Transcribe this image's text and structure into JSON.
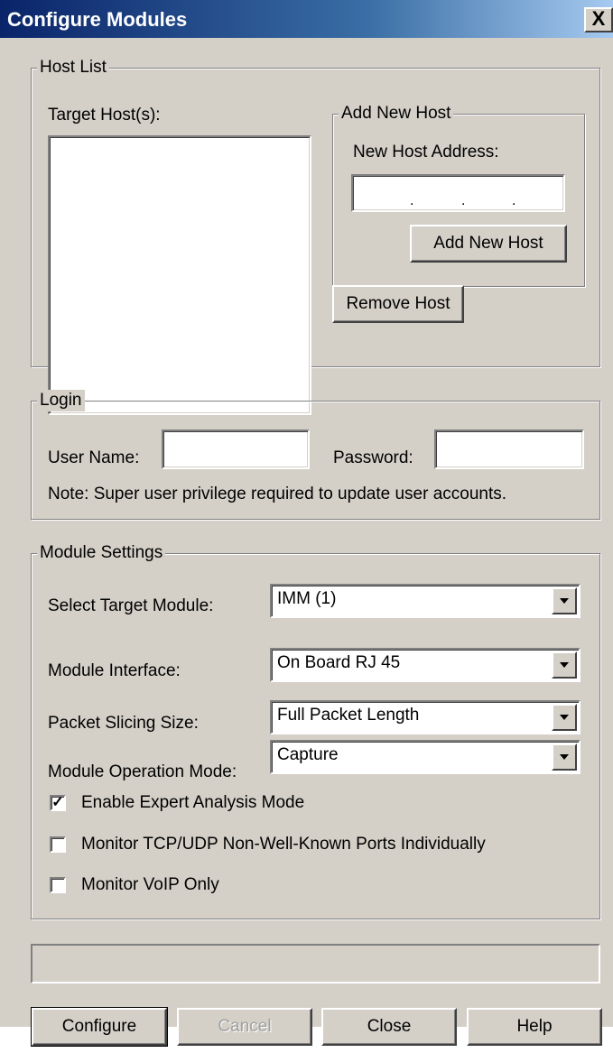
{
  "window": {
    "title": "Configure Modules",
    "close_glyph": "X"
  },
  "host_list": {
    "legend": "Host List",
    "target_hosts_label": "Target Host(s):",
    "target_hosts": [],
    "add_new_host": {
      "legend": "Add New Host",
      "address_label": "New Host Address:",
      "address_dots": [
        ".",
        ".",
        "."
      ],
      "add_button": "Add New Host"
    },
    "remove_button": "Remove Host"
  },
  "login": {
    "legend": "Login",
    "user_name_label": "User Name:",
    "user_name_value": "",
    "password_label": "Password:",
    "password_value": "",
    "note": "Note: Super user privilege required to update user accounts."
  },
  "module_settings": {
    "legend": "Module Settings",
    "target_module_label": "Select Target Module:",
    "target_module_value": "IMM (1)",
    "interface_label": "Module Interface:",
    "interface_value": "On Board RJ 45",
    "slicing_label": "Packet Slicing Size:",
    "slicing_value": "Full Packet Length",
    "operation_label": "Module Operation Mode:",
    "operation_value": "Capture",
    "options": [
      {
        "label": "Enable Expert Analysis Mode",
        "checked": true
      },
      {
        "label": "Monitor TCP/UDP Non-Well-Known Ports Individually",
        "checked": false
      },
      {
        "label": "Monitor VoIP Only",
        "checked": false
      }
    ]
  },
  "status_text": "",
  "buttons": {
    "configure": "Configure",
    "cancel": "Cancel",
    "close": "Close",
    "help": "Help"
  }
}
